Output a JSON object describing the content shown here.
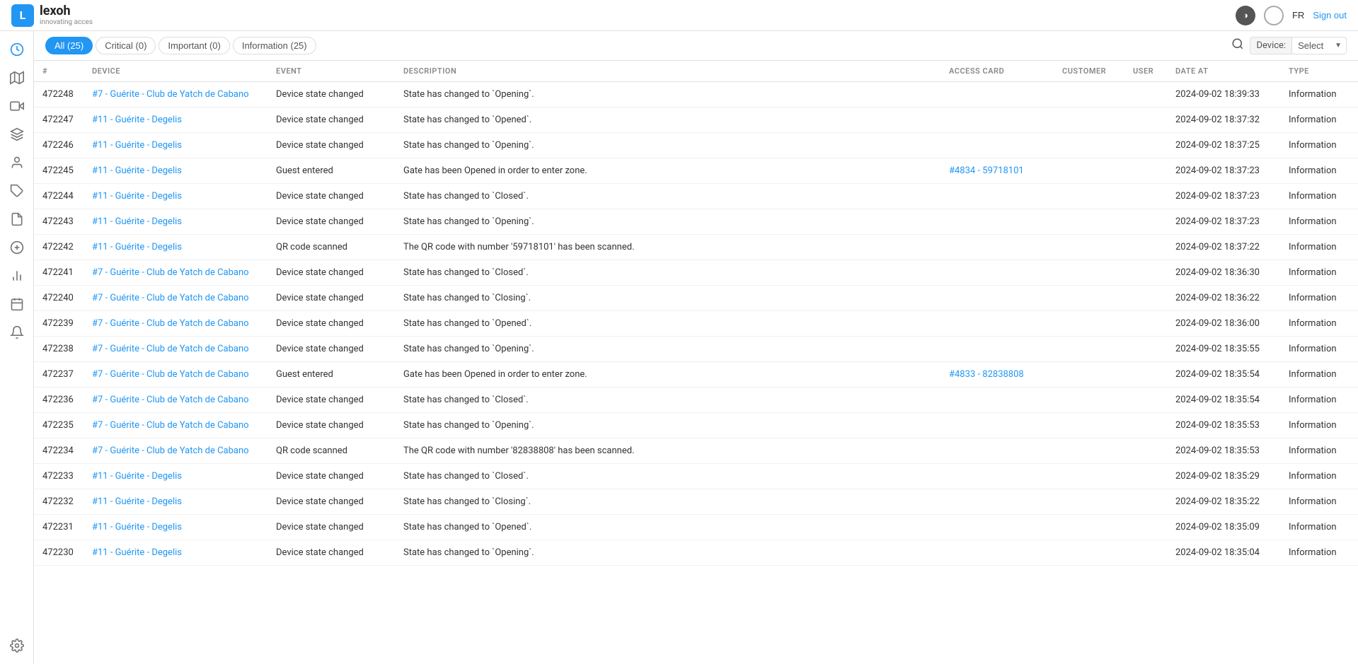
{
  "header": {
    "logo_letter": "L",
    "logo_name": "lexoh",
    "logo_sub": "innovating acces",
    "lang": "FR",
    "signout": "Sign out"
  },
  "filters": {
    "tabs": [
      {
        "label": "All (25)",
        "active": true
      },
      {
        "label": "Critical (0)",
        "active": false
      },
      {
        "label": "Important (0)",
        "active": false
      },
      {
        "label": "Information (25)",
        "active": false
      }
    ],
    "device_label": "Device:",
    "device_placeholder": "Select"
  },
  "table": {
    "columns": [
      "#",
      "DEVICE",
      "EVENT",
      "DESCRIPTION",
      "ACCESS CARD",
      "CUSTOMER",
      "USER",
      "DATE AT",
      "TYPE"
    ],
    "rows": [
      {
        "id": "472248",
        "device": "#7 - Guérite - Club de Yatch de Cabano",
        "event": "Device state changed",
        "description": "State has changed to `Opening`.",
        "access_card": "",
        "customer": "",
        "user": "",
        "date": "2024-09-02 18:39:33",
        "type": "Information"
      },
      {
        "id": "472247",
        "device": "#11 - Guérite - Degelis",
        "event": "Device state changed",
        "description": "State has changed to `Opened`.",
        "access_card": "",
        "customer": "",
        "user": "",
        "date": "2024-09-02 18:37:32",
        "type": "Information"
      },
      {
        "id": "472246",
        "device": "#11 - Guérite - Degelis",
        "event": "Device state changed",
        "description": "State has changed to `Opening`.",
        "access_card": "",
        "customer": "",
        "user": "",
        "date": "2024-09-02 18:37:25",
        "type": "Information"
      },
      {
        "id": "472245",
        "device": "#11 - Guérite - Degelis",
        "event": "Guest entered",
        "description": "Gate has been Opened in order to enter zone.",
        "access_card": "#4834 - 59718101",
        "customer": "",
        "user": "",
        "date": "2024-09-02 18:37:23",
        "type": "Information"
      },
      {
        "id": "472244",
        "device": "#11 - Guérite - Degelis",
        "event": "Device state changed",
        "description": "State has changed to `Closed`.",
        "access_card": "",
        "customer": "",
        "user": "",
        "date": "2024-09-02 18:37:23",
        "type": "Information"
      },
      {
        "id": "472243",
        "device": "#11 - Guérite - Degelis",
        "event": "Device state changed",
        "description": "State has changed to `Opening`.",
        "access_card": "",
        "customer": "",
        "user": "",
        "date": "2024-09-02 18:37:23",
        "type": "Information"
      },
      {
        "id": "472242",
        "device": "#11 - Guérite - Degelis",
        "event": "QR code scanned",
        "description": "The QR code with number '59718101' has been scanned.",
        "access_card": "",
        "customer": "",
        "user": "",
        "date": "2024-09-02 18:37:22",
        "type": "Information"
      },
      {
        "id": "472241",
        "device": "#7 - Guérite - Club de Yatch de Cabano",
        "event": "Device state changed",
        "description": "State has changed to `Closed`.",
        "access_card": "",
        "customer": "",
        "user": "",
        "date": "2024-09-02 18:36:30",
        "type": "Information"
      },
      {
        "id": "472240",
        "device": "#7 - Guérite - Club de Yatch de Cabano",
        "event": "Device state changed",
        "description": "State has changed to `Closing`.",
        "access_card": "",
        "customer": "",
        "user": "",
        "date": "2024-09-02 18:36:22",
        "type": "Information"
      },
      {
        "id": "472239",
        "device": "#7 - Guérite - Club de Yatch de Cabano",
        "event": "Device state changed",
        "description": "State has changed to `Opened`.",
        "access_card": "",
        "customer": "",
        "user": "",
        "date": "2024-09-02 18:36:00",
        "type": "Information"
      },
      {
        "id": "472238",
        "device": "#7 - Guérite - Club de Yatch de Cabano",
        "event": "Device state changed",
        "description": "State has changed to `Opening`.",
        "access_card": "",
        "customer": "",
        "user": "",
        "date": "2024-09-02 18:35:55",
        "type": "Information"
      },
      {
        "id": "472237",
        "device": "#7 - Guérite - Club de Yatch de Cabano",
        "event": "Guest entered",
        "description": "Gate has been Opened in order to enter zone.",
        "access_card": "#4833 - 82838808",
        "customer": "",
        "user": "",
        "date": "2024-09-02 18:35:54",
        "type": "Information"
      },
      {
        "id": "472236",
        "device": "#7 - Guérite - Club de Yatch de Cabano",
        "event": "Device state changed",
        "description": "State has changed to `Closed`.",
        "access_card": "",
        "customer": "",
        "user": "",
        "date": "2024-09-02 18:35:54",
        "type": "Information"
      },
      {
        "id": "472235",
        "device": "#7 - Guérite - Club de Yatch de Cabano",
        "event": "Device state changed",
        "description": "State has changed to `Opening`.",
        "access_card": "",
        "customer": "",
        "user": "",
        "date": "2024-09-02 18:35:53",
        "type": "Information"
      },
      {
        "id": "472234",
        "device": "#7 - Guérite - Club de Yatch de Cabano",
        "event": "QR code scanned",
        "description": "The QR code with number '82838808' has been scanned.",
        "access_card": "",
        "customer": "",
        "user": "",
        "date": "2024-09-02 18:35:53",
        "type": "Information"
      },
      {
        "id": "472233",
        "device": "#11 - Guérite - Degelis",
        "event": "Device state changed",
        "description": "State has changed to `Closed`.",
        "access_card": "",
        "customer": "",
        "user": "",
        "date": "2024-09-02 18:35:29",
        "type": "Information"
      },
      {
        "id": "472232",
        "device": "#11 - Guérite - Degelis",
        "event": "Device state changed",
        "description": "State has changed to `Closing`.",
        "access_card": "",
        "customer": "",
        "user": "",
        "date": "2024-09-02 18:35:22",
        "type": "Information"
      },
      {
        "id": "472231",
        "device": "#11 - Guérite - Degelis",
        "event": "Device state changed",
        "description": "State has changed to `Opened`.",
        "access_card": "",
        "customer": "",
        "user": "",
        "date": "2024-09-02 18:35:09",
        "type": "Information"
      },
      {
        "id": "472230",
        "device": "#11 - Guérite - Degelis",
        "event": "Device state changed",
        "description": "State has changed to `Opening`.",
        "access_card": "",
        "customer": "",
        "user": "",
        "date": "2024-09-02 18:35:04",
        "type": "Information"
      }
    ]
  },
  "sidebar": {
    "icons": [
      {
        "name": "clock-icon",
        "symbol": "🕐"
      },
      {
        "name": "map-icon",
        "symbol": "🗺"
      },
      {
        "name": "camera-icon",
        "symbol": "📹"
      },
      {
        "name": "layers-icon",
        "symbol": "⊞"
      },
      {
        "name": "person-icon",
        "symbol": "👤"
      },
      {
        "name": "tag-icon",
        "symbol": "🏷"
      },
      {
        "name": "document-icon",
        "symbol": "📄"
      },
      {
        "name": "money-icon",
        "symbol": "💰"
      },
      {
        "name": "chart-icon",
        "symbol": "📊"
      },
      {
        "name": "calendar-icon",
        "symbol": "📅"
      },
      {
        "name": "bell-icon",
        "symbol": "🔔"
      },
      {
        "name": "settings-icon",
        "symbol": "⚙"
      }
    ]
  }
}
